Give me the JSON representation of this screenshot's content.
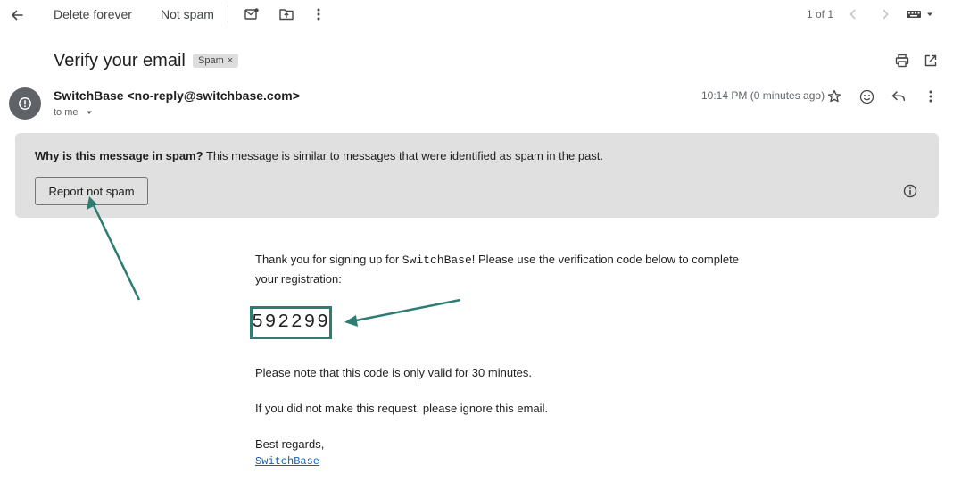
{
  "toolbar": {
    "back_icon": "arrow-left-icon",
    "delete_forever_label": "Delete forever",
    "not_spam_label": "Not spam",
    "mark_unread_icon": "mark-unread-icon",
    "move_to_icon": "move-to-folder-icon",
    "more_icon": "more-vert-icon",
    "pager_text": "1 of 1",
    "prev_icon": "chevron-left-icon",
    "next_icon": "chevron-right-icon",
    "input_tools_icon": "keyboard-icon"
  },
  "subject": {
    "title": "Verify your email",
    "label_chip": "Spam",
    "chip_remove": "×",
    "print_icon": "print-icon",
    "open_new_window_icon": "open-in-new-icon"
  },
  "message": {
    "sender_name": "SwitchBase",
    "sender_email": "<no-reply@switchbase.com>",
    "to_label": "to me",
    "time": "10:14 PM (0 minutes ago)",
    "star_icon": "star-icon",
    "emoji_icon": "emoji-icon",
    "reply_icon": "reply-icon",
    "more_icon": "more-vert-icon"
  },
  "spam_banner": {
    "question": "Why is this message in spam?",
    "explanation": " This message is similar to messages that were identified as spam in the past.",
    "report_button": "Report not spam",
    "info_icon": "info-icon"
  },
  "email_body": {
    "intro_part1": "Thank you for signing up for ",
    "intro_brand": "SwitchBase",
    "intro_part2": "! Please use the verification code below to complete",
    "intro_line2": "your registration:",
    "code": "592299",
    "validity_note": "Please note that this code is only valid for 30 minutes.",
    "ignore_note": "If you did not make this request, please ignore this email.",
    "sign_off": "Best regards,",
    "signature_link": "SwitchBase"
  },
  "colors": {
    "annotation_arrow": "#2e7d73",
    "banner_bg": "#e0e0e0",
    "link": "#1a5fb4"
  }
}
